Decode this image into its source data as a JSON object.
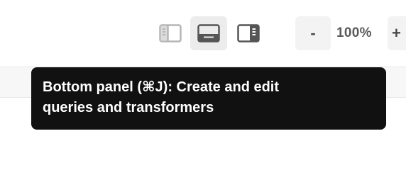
{
  "toolbar": {
    "panel_buttons": [
      {
        "name": "left-panel-toggle",
        "icon": "left-panel-icon",
        "active": false
      },
      {
        "name": "bottom-panel-toggle",
        "icon": "bottom-panel-icon",
        "active": true
      },
      {
        "name": "right-panel-toggle",
        "icon": "right-panel-icon",
        "active": false
      }
    ],
    "zoom": {
      "decrease_label": "-",
      "value": "100%",
      "increase_label": "+"
    }
  },
  "tooltip": {
    "line1": "Bottom panel (⌘J): Create and edit",
    "line2": "queries and transformers"
  },
  "colors": {
    "tooltip_bg": "#111111",
    "active_button_bg": "#ececec",
    "icon_dark": "#555555",
    "icon_light": "#b5b5b5"
  }
}
